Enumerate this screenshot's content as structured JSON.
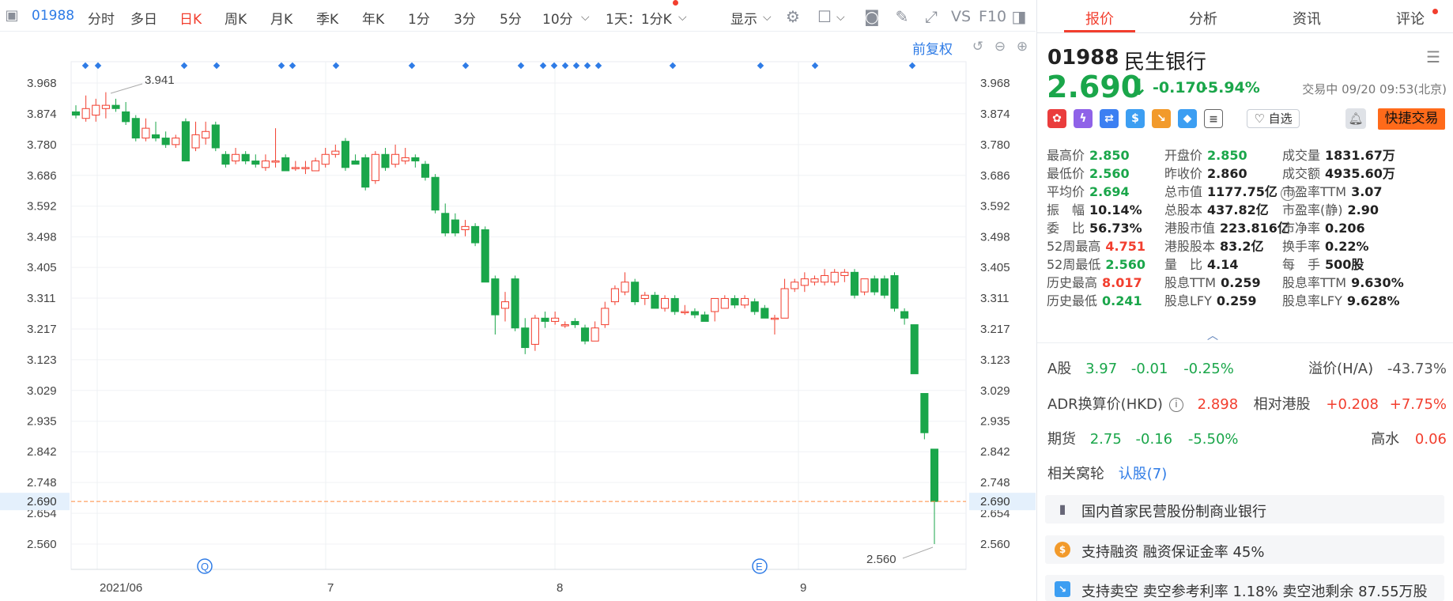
{
  "toolbar": {
    "code": "01988",
    "periods": [
      "分时",
      "多日",
      "日K",
      "周K",
      "月K",
      "季K",
      "年K",
      "1分",
      "3分",
      "5分",
      "10分"
    ],
    "active_period": "日K",
    "interval_select": "1天：1分K",
    "display_menu": "显示",
    "vs_label": "VS",
    "f10_label": "F10"
  },
  "subbar": {
    "adjust_label": "前复权"
  },
  "chart_data": {
    "type": "candlestick",
    "y_ticks": [
      "3.968",
      "3.874",
      "3.780",
      "3.686",
      "3.592",
      "3.498",
      "3.405",
      "3.311",
      "3.217",
      "3.123",
      "3.029",
      "2.935",
      "2.842",
      "2.748",
      "2.654",
      "2.560"
    ],
    "ylim": [
      2.52,
      3.99
    ],
    "x_labels": [
      "2021/06",
      "7",
      "8",
      "9"
    ],
    "current_price_label": "2.690",
    "max_annotation": "3.941",
    "min_annotation": "2.560",
    "event_markers": [
      "Q",
      "E"
    ],
    "candles": [
      [
        3.88,
        3.87,
        3.9,
        3.86
      ],
      [
        3.86,
        3.89,
        3.93,
        3.85
      ],
      [
        3.87,
        3.9,
        3.92,
        3.85
      ],
      [
        3.89,
        3.9,
        3.94,
        3.86
      ],
      [
        3.9,
        3.89,
        3.92,
        3.88
      ],
      [
        3.88,
        3.85,
        3.91,
        3.84
      ],
      [
        3.86,
        3.8,
        3.87,
        3.79
      ],
      [
        3.8,
        3.83,
        3.86,
        3.79
      ],
      [
        3.81,
        3.8,
        3.85,
        3.79
      ],
      [
        3.8,
        3.78,
        3.82,
        3.77
      ],
      [
        3.78,
        3.8,
        3.81,
        3.77
      ],
      [
        3.85,
        3.73,
        3.86,
        3.73
      ],
      [
        3.77,
        3.81,
        3.85,
        3.76
      ],
      [
        3.8,
        3.82,
        3.85,
        3.78
      ],
      [
        3.84,
        3.77,
        3.85,
        3.76
      ],
      [
        3.75,
        3.72,
        3.76,
        3.71
      ],
      [
        3.73,
        3.75,
        3.77,
        3.72
      ],
      [
        3.75,
        3.73,
        3.76,
        3.72
      ],
      [
        3.73,
        3.72,
        3.75,
        3.71
      ],
      [
        3.71,
        3.73,
        3.75,
        3.7
      ],
      [
        3.73,
        3.73,
        3.83,
        3.71
      ],
      [
        3.74,
        3.7,
        3.75,
        3.7
      ],
      [
        3.71,
        3.71,
        3.73,
        3.7
      ],
      [
        3.71,
        3.71,
        3.73,
        3.69
      ],
      [
        3.7,
        3.73,
        3.74,
        3.7
      ],
      [
        3.72,
        3.75,
        3.77,
        3.71
      ],
      [
        3.75,
        3.76,
        3.78,
        3.74
      ],
      [
        3.79,
        3.71,
        3.8,
        3.7
      ],
      [
        3.73,
        3.72,
        3.75,
        3.72
      ],
      [
        3.74,
        3.65,
        3.75,
        3.64
      ],
      [
        3.67,
        3.75,
        3.76,
        3.66
      ],
      [
        3.75,
        3.71,
        3.77,
        3.7
      ],
      [
        3.72,
        3.75,
        3.78,
        3.71
      ],
      [
        3.73,
        3.74,
        3.77,
        3.72
      ],
      [
        3.74,
        3.73,
        3.75,
        3.71
      ],
      [
        3.72,
        3.68,
        3.73,
        3.67
      ],
      [
        3.68,
        3.58,
        3.69,
        3.57
      ],
      [
        3.57,
        3.51,
        3.6,
        3.5
      ],
      [
        3.55,
        3.51,
        3.57,
        3.5
      ],
      [
        3.52,
        3.53,
        3.55,
        3.5
      ],
      [
        3.53,
        3.48,
        3.54,
        3.47
      ],
      [
        3.52,
        3.36,
        3.53,
        3.36
      ],
      [
        3.37,
        3.26,
        3.38,
        3.2
      ],
      [
        3.28,
        3.3,
        3.33,
        3.24
      ],
      [
        3.37,
        3.22,
        3.38,
        3.21
      ],
      [
        3.22,
        3.16,
        3.25,
        3.14
      ],
      [
        3.17,
        3.25,
        3.26,
        3.15
      ],
      [
        3.25,
        3.24,
        3.27,
        3.22
      ],
      [
        3.24,
        3.25,
        3.27,
        3.23
      ],
      [
        3.23,
        3.23,
        3.24,
        3.22
      ],
      [
        3.24,
        3.23,
        3.25,
        3.22
      ],
      [
        3.22,
        3.18,
        3.23,
        3.17
      ],
      [
        3.18,
        3.22,
        3.24,
        3.18
      ],
      [
        3.23,
        3.28,
        3.3,
        3.22
      ],
      [
        3.3,
        3.34,
        3.35,
        3.29
      ],
      [
        3.33,
        3.36,
        3.39,
        3.32
      ],
      [
        3.36,
        3.3,
        3.37,
        3.29
      ],
      [
        3.31,
        3.32,
        3.33,
        3.29
      ],
      [
        3.32,
        3.28,
        3.33,
        3.28
      ],
      [
        3.28,
        3.31,
        3.32,
        3.27
      ],
      [
        3.31,
        3.27,
        3.32,
        3.26
      ],
      [
        3.27,
        3.27,
        3.29,
        3.26
      ],
      [
        3.27,
        3.26,
        3.28,
        3.25
      ],
      [
        3.26,
        3.24,
        3.27,
        3.24
      ],
      [
        3.27,
        3.31,
        3.31,
        3.24
      ],
      [
        3.28,
        3.31,
        3.32,
        3.28
      ],
      [
        3.31,
        3.29,
        3.32,
        3.28
      ],
      [
        3.29,
        3.31,
        3.32,
        3.28
      ],
      [
        3.3,
        3.27,
        3.31,
        3.26
      ],
      [
        3.28,
        3.25,
        3.29,
        3.25
      ],
      [
        3.25,
        3.25,
        3.26,
        3.2
      ],
      [
        3.25,
        3.34,
        3.37,
        3.25
      ],
      [
        3.34,
        3.36,
        3.37,
        3.33
      ],
      [
        3.35,
        3.37,
        3.39,
        3.33
      ],
      [
        3.36,
        3.37,
        3.38,
        3.35
      ],
      [
        3.36,
        3.38,
        3.4,
        3.35
      ],
      [
        3.36,
        3.39,
        3.4,
        3.35
      ],
      [
        3.38,
        3.39,
        3.4,
        3.36
      ],
      [
        3.39,
        3.32,
        3.4,
        3.31
      ],
      [
        3.33,
        3.37,
        3.37,
        3.32
      ],
      [
        3.37,
        3.33,
        3.38,
        3.32
      ],
      [
        3.37,
        3.32,
        3.38,
        3.31
      ],
      [
        3.38,
        3.28,
        3.39,
        3.27
      ],
      [
        3.27,
        3.25,
        3.28,
        3.23
      ],
      [
        3.23,
        3.08,
        3.23,
        3.08
      ],
      [
        3.02,
        2.9,
        3.02,
        2.88
      ],
      [
        2.85,
        2.69,
        2.85,
        2.56
      ]
    ]
  },
  "tabs": [
    "报价",
    "分析",
    "资讯",
    "评论"
  ],
  "quote": {
    "code": "01988",
    "name": "民生银行",
    "price": "2.690",
    "change": "-0.170",
    "change_pct": "-5.94%",
    "status": "交易中 09/20 09:53(北京)",
    "watch_label": "自选",
    "quick_trade": "快捷交易",
    "rows": [
      [
        {
          "label": "最高价",
          "value": "2.850",
          "color": "green"
        },
        {
          "label": "开盘价",
          "value": "2.850",
          "color": "green"
        },
        {
          "label": "成交量",
          "value": "1831.67万",
          "color": "dark"
        }
      ],
      [
        {
          "label": "最低价",
          "value": "2.560",
          "color": "green"
        },
        {
          "label": "昨收价",
          "value": "2.860",
          "color": "dark"
        },
        {
          "label": "成交额",
          "value": "4935.60万",
          "color": "dark"
        }
      ],
      [
        {
          "label": "平均价",
          "value": "2.694",
          "color": "green"
        },
        {
          "label": "总市值",
          "value": "1177.75亿",
          "color": "dark"
        },
        {
          "label": "市盈率TTM",
          "value": "3.07",
          "color": "dark"
        }
      ],
      [
        {
          "label": "振　幅",
          "value": "10.14%",
          "color": "dark"
        },
        {
          "label": "总股本",
          "value": "437.82亿",
          "color": "dark"
        },
        {
          "label": "市盈率(静)",
          "value": "2.90",
          "color": "dark"
        }
      ],
      [
        {
          "label": "委　比",
          "value": "56.73%",
          "color": "dark"
        },
        {
          "label": "港股市值",
          "value": "223.816亿",
          "color": "dark"
        },
        {
          "label": "市净率",
          "value": "0.206",
          "color": "dark"
        }
      ],
      [
        {
          "label": "52周最高",
          "value": "4.751",
          "color": "red"
        },
        {
          "label": "港股股本",
          "value": "83.2亿",
          "color": "dark"
        },
        {
          "label": "换手率",
          "value": "0.22%",
          "color": "dark"
        }
      ],
      [
        {
          "label": "52周最低",
          "value": "2.560",
          "color": "green"
        },
        {
          "label": "量　比",
          "value": "4.14",
          "color": "dark"
        },
        {
          "label": "每　手",
          "value": "500股",
          "color": "dark"
        }
      ],
      [
        {
          "label": "历史最高",
          "value": "8.017",
          "color": "red"
        },
        {
          "label": "股息TTM",
          "value": "0.259",
          "color": "dark"
        },
        {
          "label": "股息率TTM",
          "value": "9.630%",
          "color": "dark"
        }
      ],
      [
        {
          "label": "历史最低",
          "value": "0.241",
          "color": "green"
        },
        {
          "label": "股息LFY",
          "value": "0.259",
          "color": "dark"
        },
        {
          "label": "股息率LFY",
          "value": "9.628%",
          "color": "dark"
        }
      ]
    ],
    "a_share": {
      "label": "A股",
      "price": "3.97",
      "change": "-0.01",
      "pct": "-0.25%",
      "premium_label": "溢价(H/A)",
      "premium": "-43.73%"
    },
    "adr": {
      "label": "ADR换算价(HKD)",
      "price": "2.898",
      "rel_label": "相对港股",
      "rel_change": "+0.208",
      "rel_pct": "+7.75%"
    },
    "futures": {
      "label": "期货",
      "price": "2.75",
      "change": "-0.16",
      "pct": "-5.50%",
      "water_label": "高水",
      "water": "0.06"
    },
    "warrants": {
      "label": "相关窝轮",
      "link": "认股(7)"
    },
    "tags": [
      {
        "text": "国内首家民营股份制商业银行",
        "icon": "book-icon"
      },
      {
        "text": "支持融资 融资保证金率 45%",
        "icon": "dollar-icon"
      },
      {
        "text": "支持卖空 卖空参考利率 1.18% 卖空池剩余 87.55万股",
        "icon": "short-icon"
      }
    ]
  },
  "colors": {
    "up": "#f23e2e",
    "down": "#1aa64a",
    "accent": "#2e7be6",
    "orange": "#ff6a1a"
  }
}
